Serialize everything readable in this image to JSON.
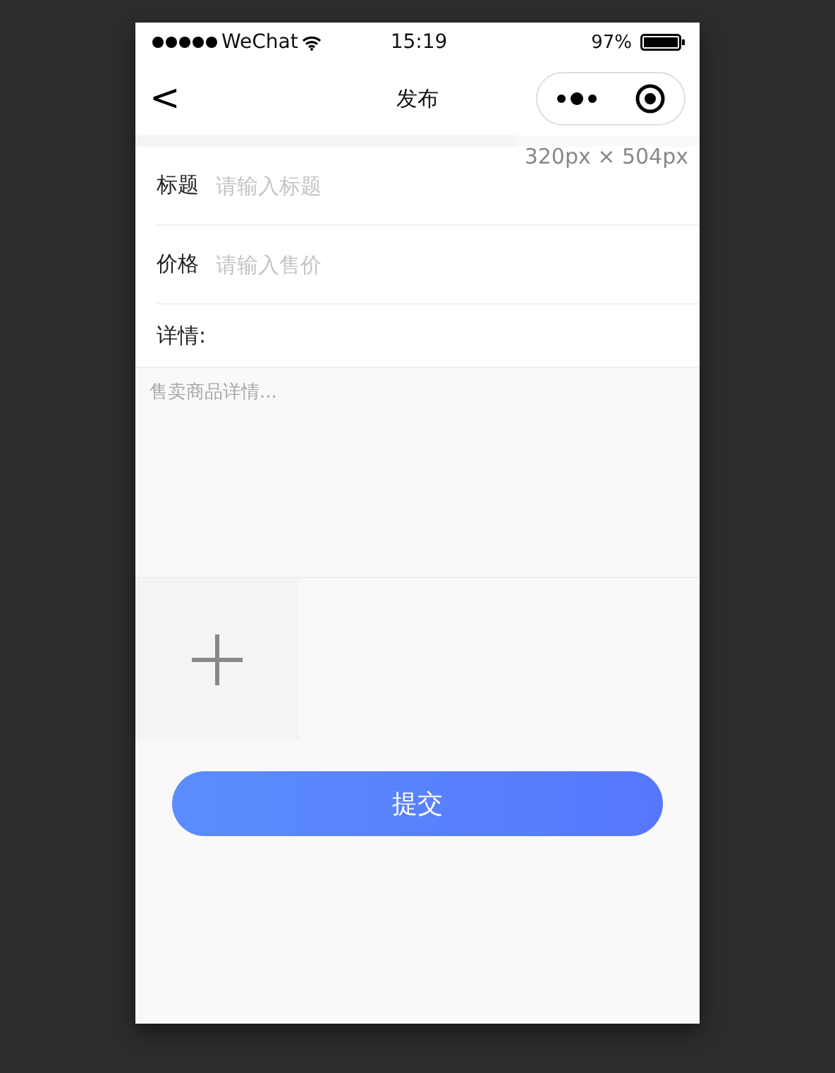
{
  "status_bar": {
    "carrier": "WeChat",
    "time": "15:19",
    "battery": "97%"
  },
  "nav": {
    "back": "<",
    "title": "发布"
  },
  "size_overlay": "320px × 504px",
  "fields": [
    {
      "label": "标题",
      "placeholder": "请输入标题"
    },
    {
      "label": "价格",
      "placeholder": "请输入售价"
    }
  ],
  "details": {
    "label": "详情:",
    "placeholder": "售卖商品详情..."
  },
  "submit": "提交"
}
